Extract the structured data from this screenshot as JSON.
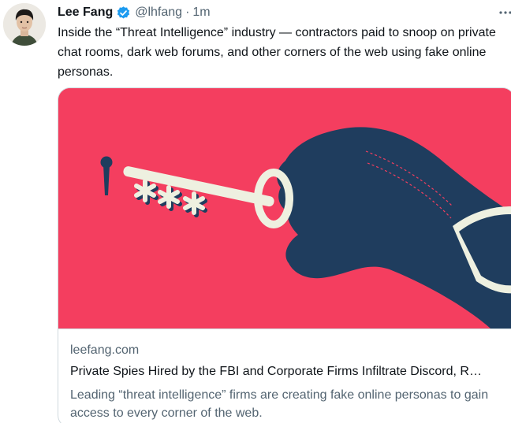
{
  "tweet": {
    "author_name": "Lee Fang",
    "handle": "@lhfang",
    "separator": "·",
    "time": "1m",
    "text": "Inside the “Threat Intelligence” industry — contractors paid to snoop on private chat rooms, dark web forums, and other corners of the web using fake online personas."
  },
  "card": {
    "domain": "leefang.com",
    "title": "Private Spies Hired by the FBI and Corporate Firms Infiltrate Discord, R…",
    "description": "Leading “threat intelligence” firms are creating fake online personas to gain access to every corner of the web.",
    "image_background": "#f43e5f",
    "image_accent": "#1f3d5e",
    "image_key_color": "#eef0e0"
  },
  "icons": {
    "verified": "verified-badge-icon",
    "more": "more-options-icon"
  },
  "colors": {
    "secondary_text": "#536471",
    "verified_blue": "#1d9bf0",
    "border": "#cfd9de"
  }
}
